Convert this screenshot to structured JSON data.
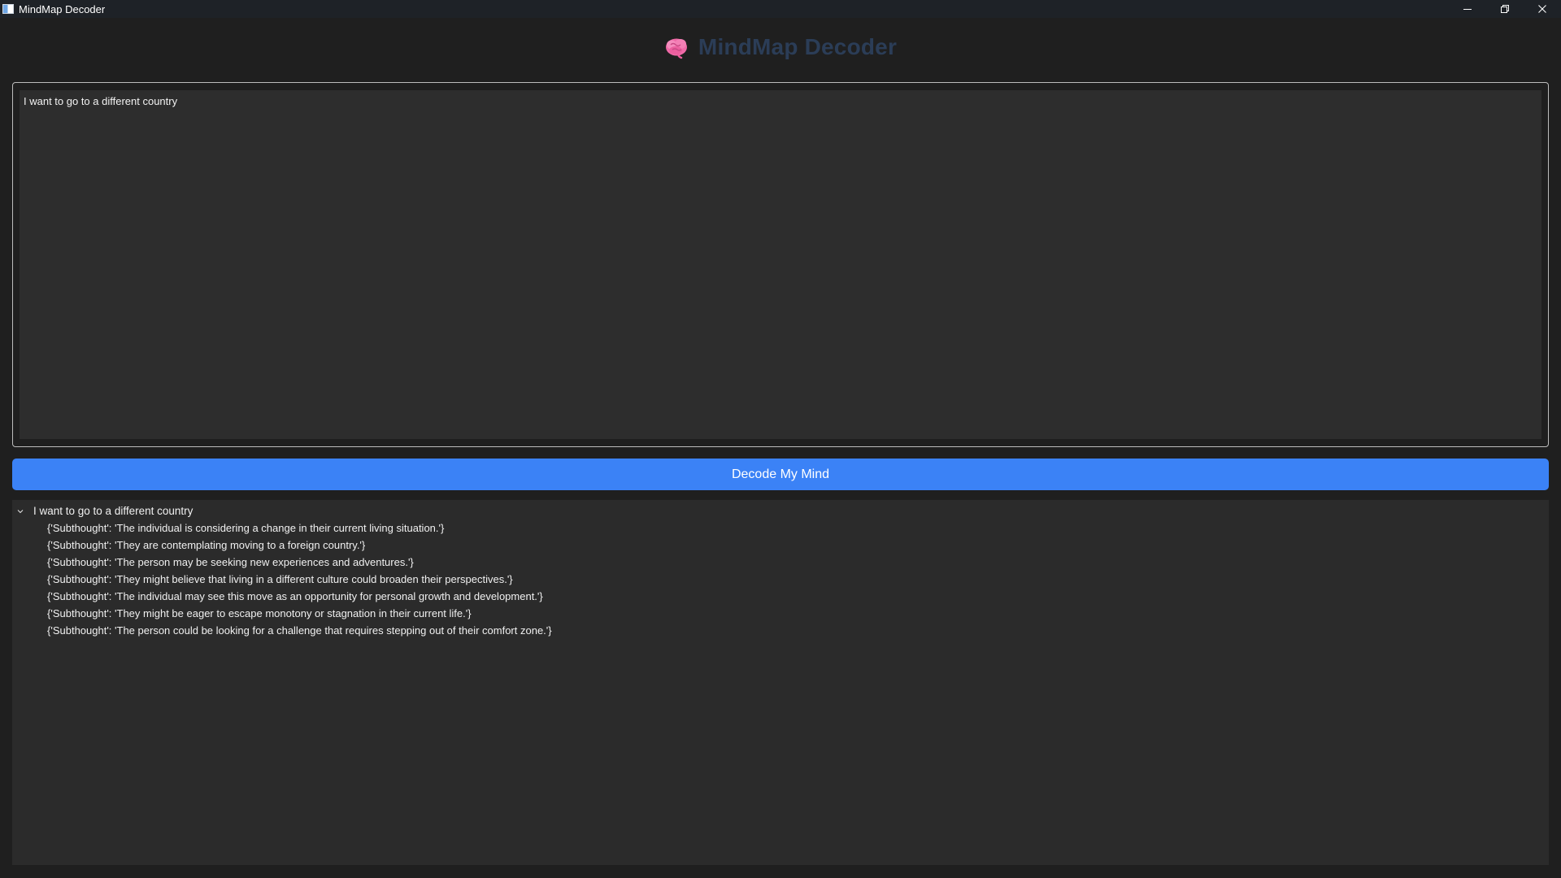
{
  "window": {
    "title": "MindMap Decoder"
  },
  "header": {
    "icon": "brain-icon",
    "title": "MindMap Decoder"
  },
  "input": {
    "value": "I want to go to a different country"
  },
  "decode_button": {
    "label": "Decode My Mind"
  },
  "tree": {
    "root_label": "I want to go to a different country",
    "expanded": true,
    "children": [
      "{'Subthought': 'The individual is considering a change in their current living situation.'}",
      "{'Subthought': 'They are contemplating moving to a foreign country.'}",
      "{'Subthought': 'The person may be seeking new experiences and adventures.'}",
      "{'Subthought': 'They might believe that living in a different culture could broaden their perspectives.'}",
      "{'Subthought': 'The individual may see this move as an opportunity for personal growth and development.'}",
      "{'Subthought': 'They might be eager to escape monotony or stagnation in their current life.'}",
      "{'Subthought': 'The person could be looking for a challenge that requires stepping out of their comfort zone.'}"
    ]
  },
  "colors": {
    "background": "#1f1f1f",
    "titlebar": "#1e2227",
    "header_title": "#2b3d57",
    "button": "#3b82f6",
    "panel": "#2b2b2b"
  }
}
